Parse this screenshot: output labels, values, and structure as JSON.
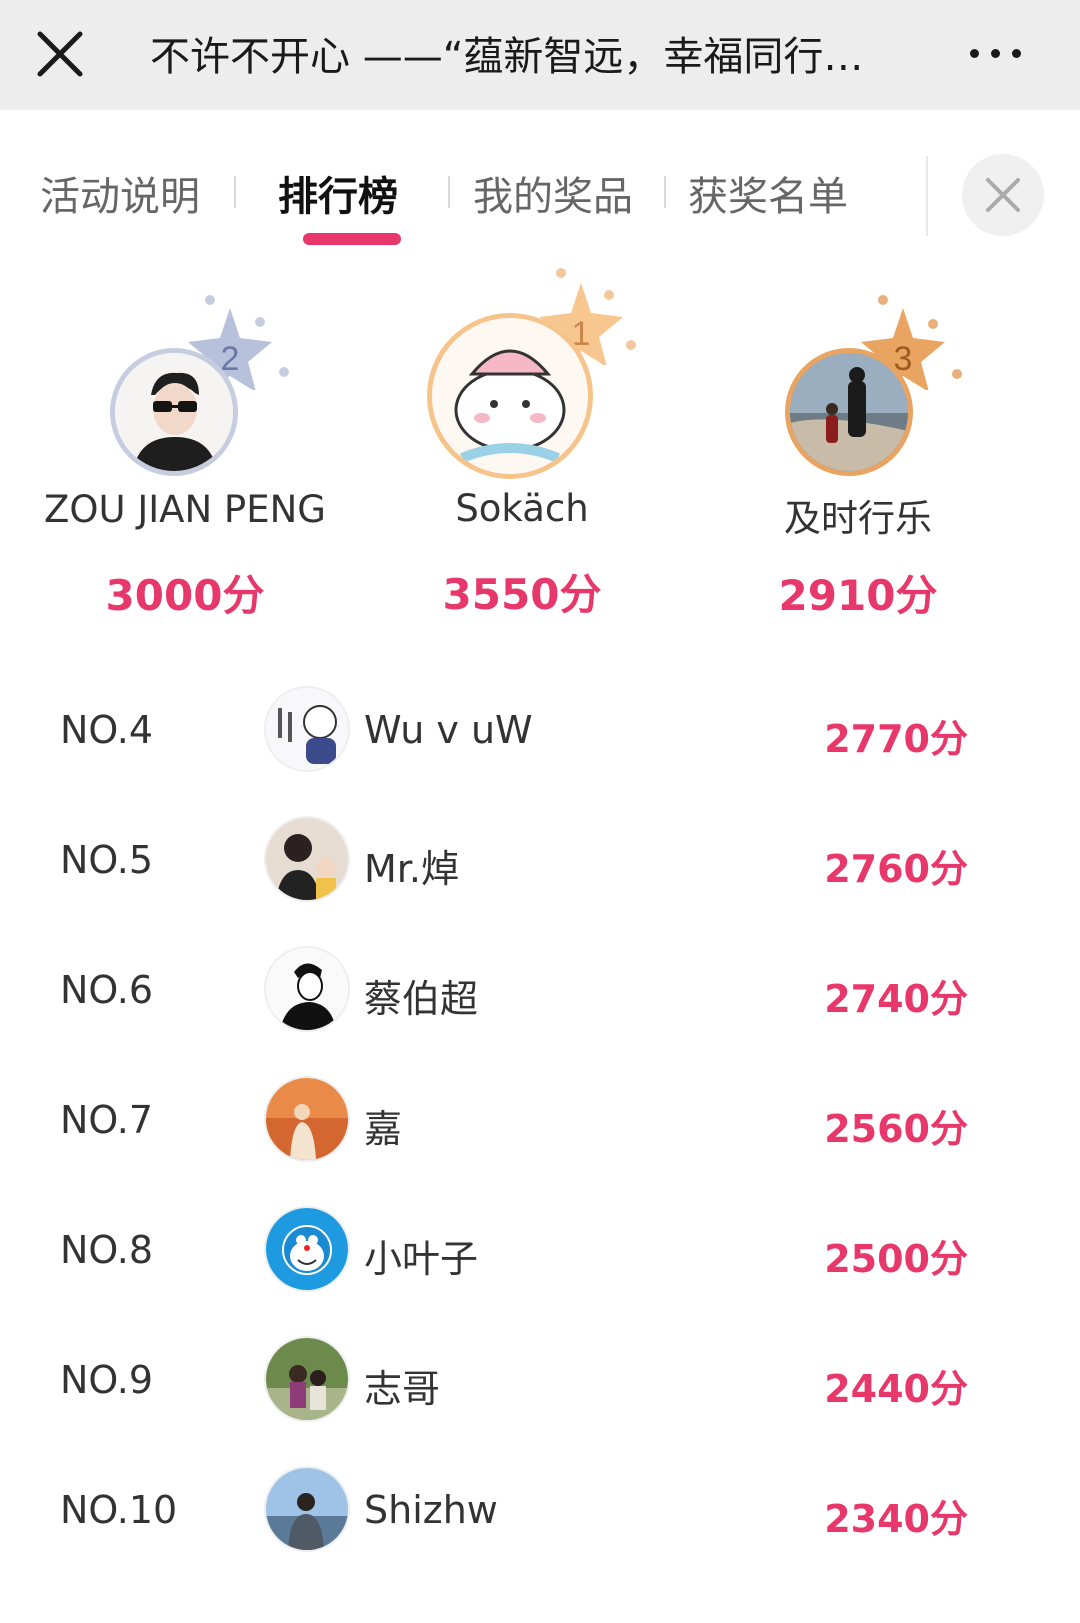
{
  "header": {
    "title": "不许不开心 ——“蕴新智远，幸福同行…",
    "close_icon": "close-icon",
    "more_icon": "more-dots-icon"
  },
  "tabs": [
    {
      "label": "活动说明",
      "active": false
    },
    {
      "label": "排行榜",
      "active": true
    },
    {
      "label": "我的奖品",
      "active": false
    },
    {
      "label": "获奖名单",
      "active": false
    }
  ],
  "podium": [
    {
      "rank": "2",
      "name": "ZOU JIAN PENG",
      "score": "3000分",
      "color": "#b7c1dc"
    },
    {
      "rank": "1",
      "name": "Sokäch",
      "score": "3550分",
      "color": "#f6c48a"
    },
    {
      "rank": "3",
      "name": "及时行乐",
      "score": "2910分",
      "color": "#e8a460"
    }
  ],
  "ranking": [
    {
      "rank": "NO.4",
      "name": "Wu v uW",
      "score": "2770分"
    },
    {
      "rank": "NO.5",
      "name": "Mr.焯",
      "score": "2760分"
    },
    {
      "rank": "NO.6",
      "name": "蔡伯超",
      "score": "2740分"
    },
    {
      "rank": "NO.7",
      "name": "嘉",
      "score": "2560分"
    },
    {
      "rank": "NO.8",
      "name": "小叶子",
      "score": "2500分"
    },
    {
      "rank": "NO.9",
      "name": "志哥",
      "score": "2440分"
    },
    {
      "rank": "NO.10",
      "name": "Shizhw",
      "score": "2340分"
    }
  ],
  "colors": {
    "accent": "#e8386b"
  }
}
